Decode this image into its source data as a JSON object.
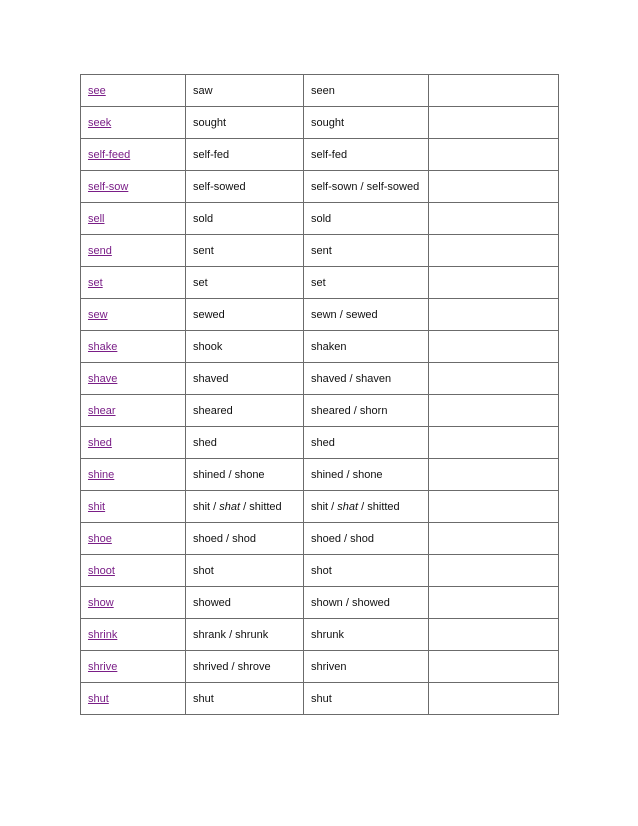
{
  "link_color": "#7a1e87",
  "rows": [
    {
      "base": "see",
      "past": "saw",
      "participle": "seen"
    },
    {
      "base": "seek",
      "past": "sought",
      "participle": "sought"
    },
    {
      "base": "self-feed",
      "past": "self-fed",
      "participle": "self-fed"
    },
    {
      "base": "self-sow",
      "past": "self-sowed",
      "participle": "self-sown / self-sowed"
    },
    {
      "base": "sell",
      "past": "sold",
      "participle": "sold"
    },
    {
      "base": "send",
      "past": "sent",
      "participle": "sent"
    },
    {
      "base": "set",
      "past": "set",
      "participle": "set"
    },
    {
      "base": "sew",
      "past": "sewed",
      "participle": "sewn / sewed"
    },
    {
      "base": "shake",
      "past": "shook",
      "participle": "shaken"
    },
    {
      "base": "shave",
      "past": "shaved",
      "participle": "shaved / shaven"
    },
    {
      "base": "shear",
      "past": "sheared",
      "participle": "sheared / shorn"
    },
    {
      "base": "shed",
      "past": "shed",
      "participle": "shed"
    },
    {
      "base": "shine",
      "past": "shined / shone",
      "participle": "shined / shone"
    },
    {
      "base": "shit",
      "past_parts": [
        "shit / ",
        "shat",
        " / shitted"
      ],
      "participle_parts": [
        "shit / ",
        "shat",
        " / shitted"
      ]
    },
    {
      "base": "shoe",
      "past": "shoed / shod",
      "participle": "shoed / shod"
    },
    {
      "base": "shoot",
      "past": "shot",
      "participle": "shot"
    },
    {
      "base": "show",
      "past": "showed",
      "participle": "shown / showed"
    },
    {
      "base": "shrink",
      "past": "shrank / shrunk",
      "participle": "shrunk"
    },
    {
      "base": "shrive",
      "past": "shrived / shrove",
      "participle": "shriven"
    },
    {
      "base": "shut",
      "past": "shut",
      "participle": "shut"
    }
  ]
}
